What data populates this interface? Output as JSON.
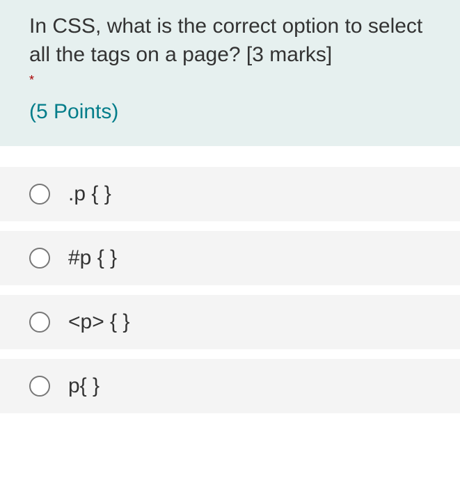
{
  "question": {
    "text": "In CSS, what is the correct option to select all the tags on a page? [3 marks]",
    "required_marker": "*",
    "points_label": "(5 Points)"
  },
  "options": [
    {
      "label": ".p { }"
    },
    {
      "label": "#p { }"
    },
    {
      "label": "<p> { }"
    },
    {
      "label": "p{ }"
    }
  ]
}
